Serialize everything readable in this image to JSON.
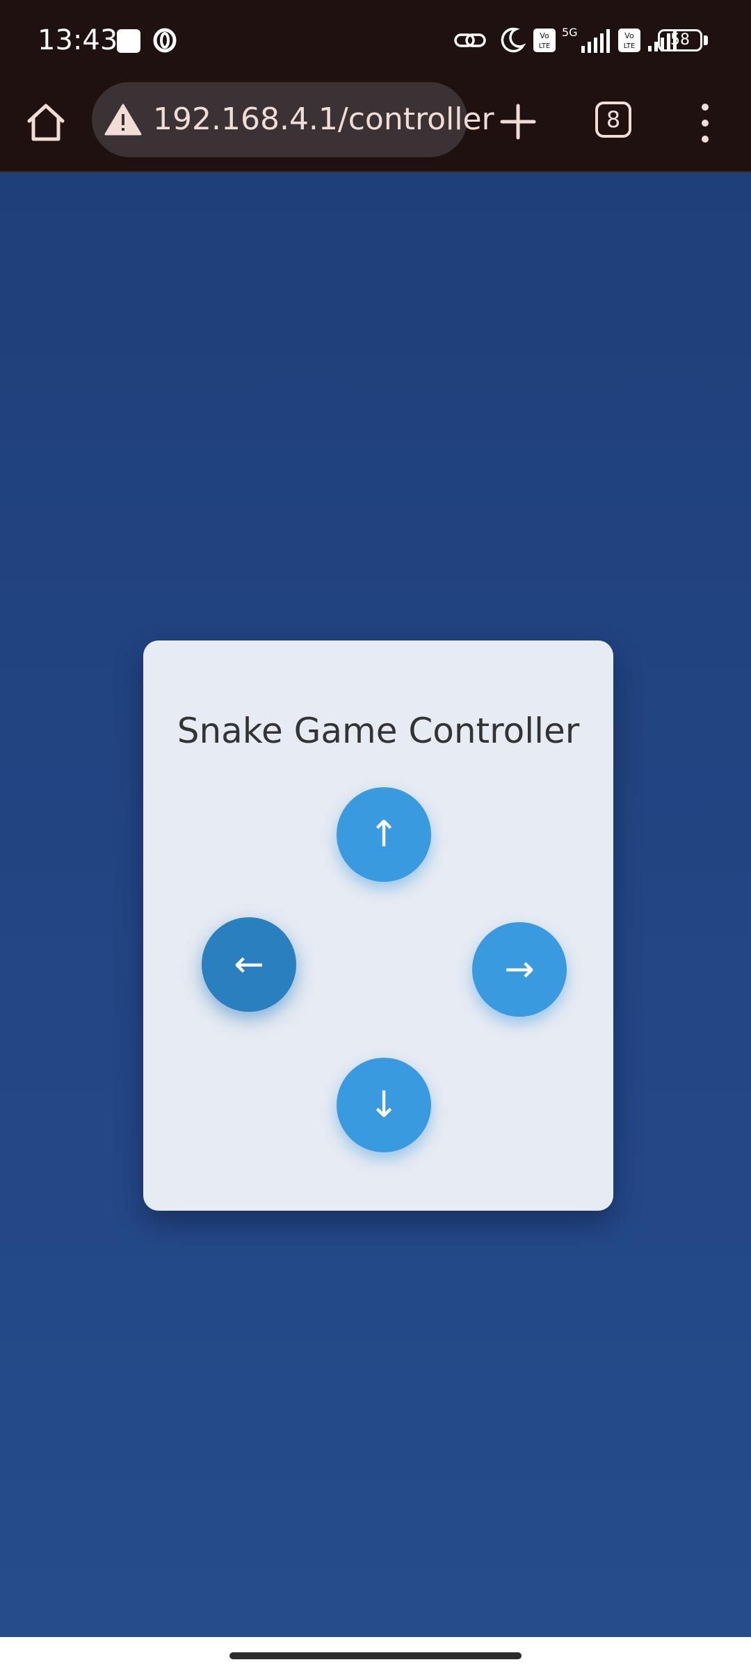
{
  "status_bar": {
    "time": "13:43",
    "battery": "58",
    "icons": [
      "notification-square-icon",
      "opera-icon",
      "link-icon",
      "moon-icon",
      "volte-icon",
      "5g-icon",
      "signal-icon",
      "volte-icon",
      "signal-icon",
      "battery-icon"
    ]
  },
  "browser": {
    "url": "192.168.4.1/controller",
    "tab_count": "8",
    "icons": [
      "home-icon",
      "warning-icon",
      "plus-icon",
      "tabs-icon",
      "menu-dots-icon"
    ]
  },
  "page": {
    "title": "Snake Game Controller",
    "background_colors": [
      "#1f3f7a",
      "#264c8c"
    ],
    "card_color": "#e7ebf3",
    "buttons": {
      "up": "↑",
      "left": "←",
      "right": "→",
      "down": "↓"
    },
    "button_color": "#3a9ae0",
    "active_button_color": "#2a80bf"
  }
}
